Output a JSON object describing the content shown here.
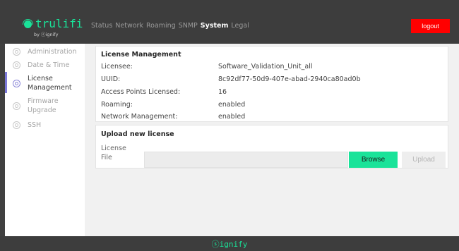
{
  "brand": {
    "name": "trulifi",
    "sub": "by ⓢignify",
    "accent": "#19e399"
  },
  "nav": {
    "items": [
      "Status",
      "Network",
      "Roaming",
      "SNMP",
      "System",
      "Legal"
    ],
    "active": "System"
  },
  "logout_label": "logout",
  "sidebar": {
    "items": [
      {
        "label_lines": [
          "Administration"
        ],
        "icon": "gear-icon"
      },
      {
        "label_lines": [
          "Date & Time"
        ],
        "icon": "clock-icon"
      },
      {
        "label_lines": [
          "License",
          "Management"
        ],
        "icon": "license-icon",
        "active": true
      },
      {
        "label_lines": [
          "Firmware",
          "Upgrade"
        ],
        "icon": "firmware-icon"
      },
      {
        "label_lines": [
          "SSH"
        ],
        "icon": "ssh-icon"
      }
    ]
  },
  "license": {
    "title": "License Management",
    "rows": [
      {
        "label": "Licensee:",
        "value": "Software_Validation_Unit_all"
      },
      {
        "label": "UUID:",
        "value": "8c92df77-50d9-407e-abad-2940ca80ad0b"
      },
      {
        "label": "Access Points Licensed:",
        "value": "16"
      },
      {
        "label": "Roaming:",
        "value": "enabled"
      },
      {
        "label": "Network Management:",
        "value": "enabled"
      }
    ]
  },
  "upload": {
    "title": "Upload new license",
    "file_label_lines": [
      "License",
      "File"
    ],
    "file_value": "",
    "browse_label": "Browse",
    "upload_label": "Upload"
  },
  "footer": {
    "logo": "ⓢignify"
  }
}
